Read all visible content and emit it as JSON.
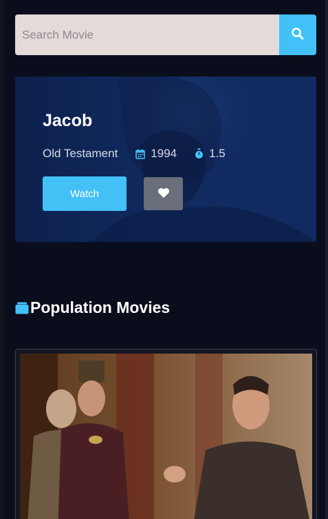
{
  "search": {
    "placeholder": "Search Movie",
    "icon": "search-icon"
  },
  "featured": {
    "title": "Jacob",
    "category": "Old Testament",
    "year": "1994",
    "rating": "1.5",
    "watch_label": "Watch",
    "icons": {
      "year": "calendar-icon",
      "rating": "stopwatch-icon",
      "favorite": "heart-icon"
    }
  },
  "section": {
    "title": "Population Movies",
    "icon": "folder-icon"
  },
  "colors": {
    "accent": "#43c1f6",
    "background": "#0a0d1b",
    "hero": "#12306a",
    "search_field": "#e4dada",
    "fav_button": "#6b6f7c"
  }
}
